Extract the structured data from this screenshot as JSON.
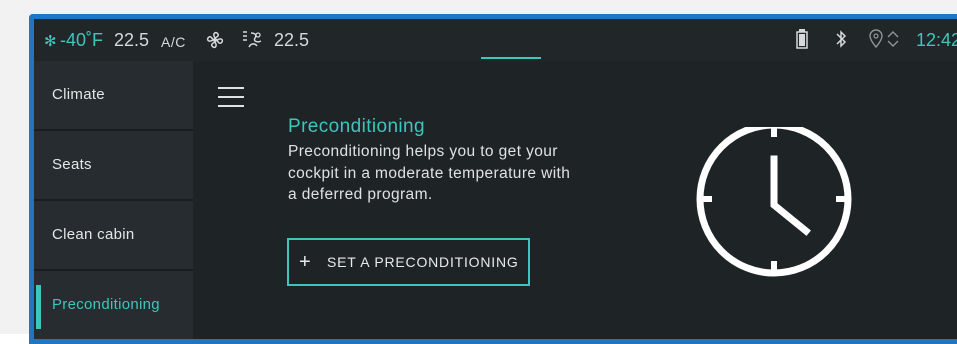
{
  "status_bar": {
    "exterior_temp": "-40˚F",
    "set_temp": "22.5",
    "ac_label": "A/C",
    "right_temp": "22.5",
    "time": "12:42",
    "icons": [
      "snowflake-icon",
      "fan-icon",
      "airflow-icon",
      "battery-icon",
      "bluetooth-icon",
      "location-icon",
      "sort-arrows-icon"
    ]
  },
  "sidebar": {
    "items": [
      {
        "label": "Climate",
        "active": false
      },
      {
        "label": "Seats",
        "active": false
      },
      {
        "label": "Clean cabin",
        "active": false
      },
      {
        "label": "Preconditioning",
        "active": true
      }
    ]
  },
  "main": {
    "title": "Preconditioning",
    "description": "Preconditioning helps you to get your cockpit in a moderate temperature with a deferred program.",
    "button_label": "SET A PRECONDITIONING",
    "button_icon": "plus-icon",
    "illustration_icon": "clock-icon"
  },
  "colors": {
    "accent": "#3cc6bd",
    "background": "#1e2326",
    "sidebar_item": "#262c30",
    "frame_border": "#1f76c2",
    "text": "#dfe2e3"
  }
}
